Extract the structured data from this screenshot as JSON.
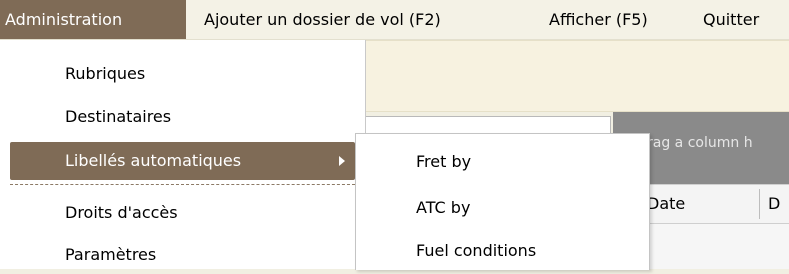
{
  "menubar": {
    "items": [
      {
        "label": "Administration"
      },
      {
        "label": "Ajouter un dossier de vol  (F2)"
      },
      {
        "label": "Afficher (F5)"
      },
      {
        "label": "Quitter"
      }
    ]
  },
  "dropdown": {
    "items": [
      {
        "label": "Rubriques"
      },
      {
        "label": "Destinataires"
      },
      {
        "label": "Libellés automatiques"
      },
      {
        "label": "Droits d'accès"
      },
      {
        "label": "Paramètres"
      }
    ]
  },
  "submenu": {
    "items": [
      {
        "label": "Fret by"
      },
      {
        "label": "ATC by"
      },
      {
        "label": "Fuel conditions"
      }
    ]
  },
  "grid": {
    "group_hint": "rag a column h",
    "columns": [
      "Date",
      "D"
    ]
  },
  "colors": {
    "menu_highlight": "#7f6b56",
    "menubar_bg": "#f4f2e6",
    "group_panel": "#8a8a8a"
  }
}
